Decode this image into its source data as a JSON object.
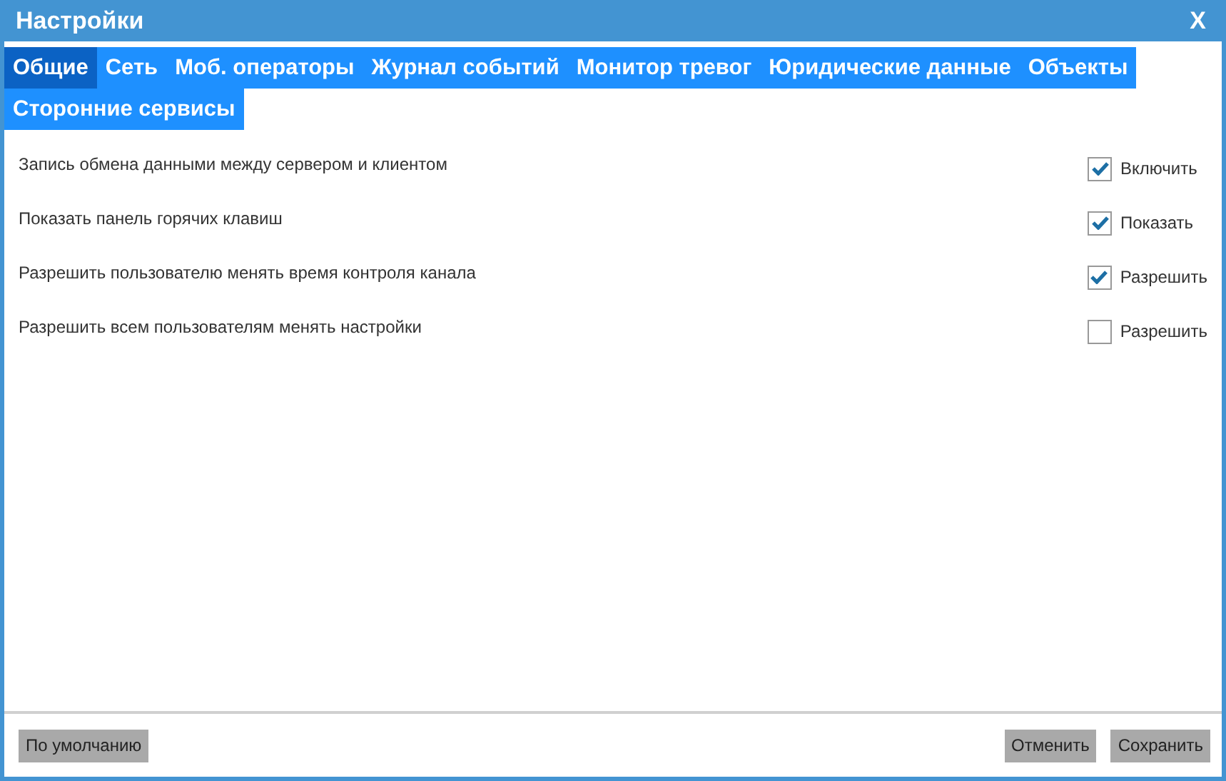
{
  "window": {
    "title": "Настройки",
    "close": "X"
  },
  "tabs": [
    {
      "label": "Общие",
      "selected": true
    },
    {
      "label": "Сеть",
      "selected": false
    },
    {
      "label": "Моб. операторы",
      "selected": false
    },
    {
      "label": "Журнал событий",
      "selected": false
    },
    {
      "label": "Монитор тревог",
      "selected": false
    },
    {
      "label": "Юридические данные",
      "selected": false
    },
    {
      "label": "Объекты",
      "selected": false
    },
    {
      "label": "Сторонние сервисы",
      "selected": false
    }
  ],
  "settings": [
    {
      "label": "Запись обмена данными между сервером и клиентом",
      "option": "Включить",
      "checked": true
    },
    {
      "label": "Показать панель горячих клавиш",
      "option": "Показать",
      "checked": true
    },
    {
      "label": "Разрешить пользователю менять время контроля канала",
      "option": "Разрешить",
      "checked": true
    },
    {
      "label": "Разрешить всем пользователям менять настройки",
      "option": "Разрешить",
      "checked": false
    }
  ],
  "footer": {
    "default_button": "По умолчанию",
    "buttons": [
      "Отменить",
      "Сохранить"
    ]
  }
}
